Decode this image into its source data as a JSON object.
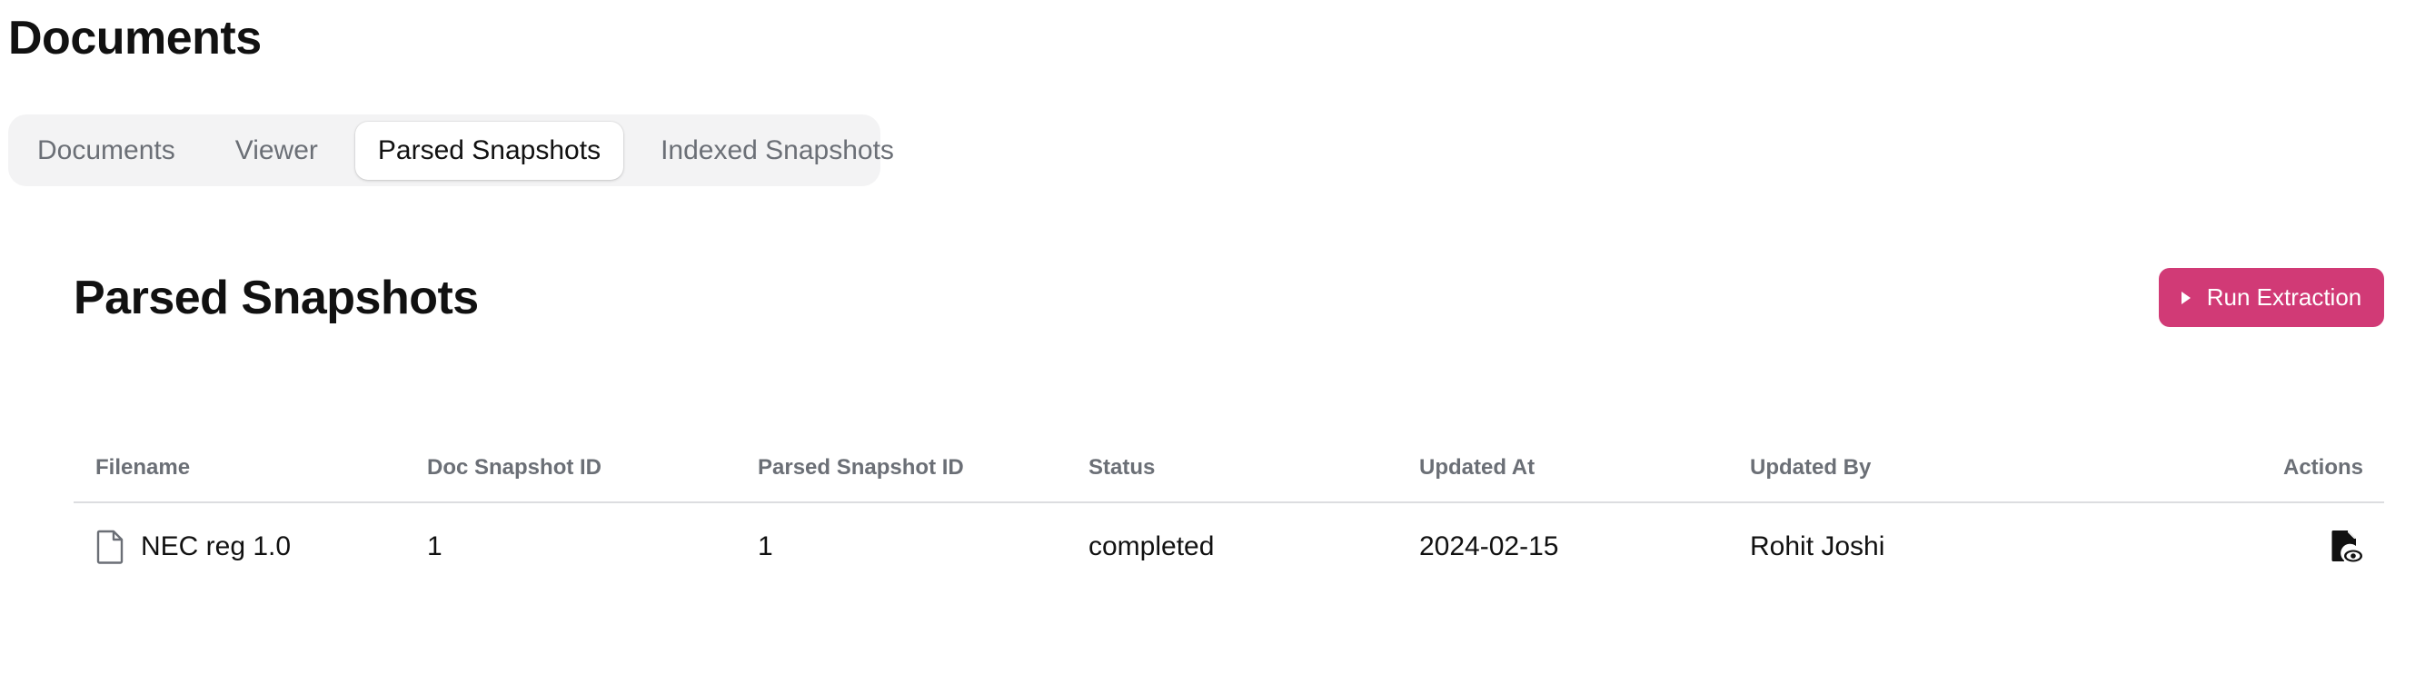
{
  "header": {
    "title": "Documents"
  },
  "tabs": [
    {
      "label": "Documents",
      "active": false
    },
    {
      "label": "Viewer",
      "active": false
    },
    {
      "label": "Parsed Snapshots",
      "active": true
    },
    {
      "label": "Indexed Snapshots",
      "active": false
    }
  ],
  "section": {
    "title": "Parsed Snapshots",
    "run_button": {
      "label": "Run Extraction",
      "icon": "play-icon",
      "color": "#d13a76"
    }
  },
  "table": {
    "columns": [
      "Filename",
      "Doc Snapshot ID",
      "Parsed Snapshot ID",
      "Status",
      "Updated At",
      "Updated By",
      "Actions"
    ],
    "rows": [
      {
        "filename": "NEC reg 1.0",
        "file_icon": "document-icon",
        "doc_snapshot_id": "1",
        "parsed_snapshot_id": "1",
        "status": "completed",
        "updated_at": "2024-02-15",
        "updated_by": "Rohit Joshi",
        "action_icon": "view-document-icon"
      }
    ]
  }
}
